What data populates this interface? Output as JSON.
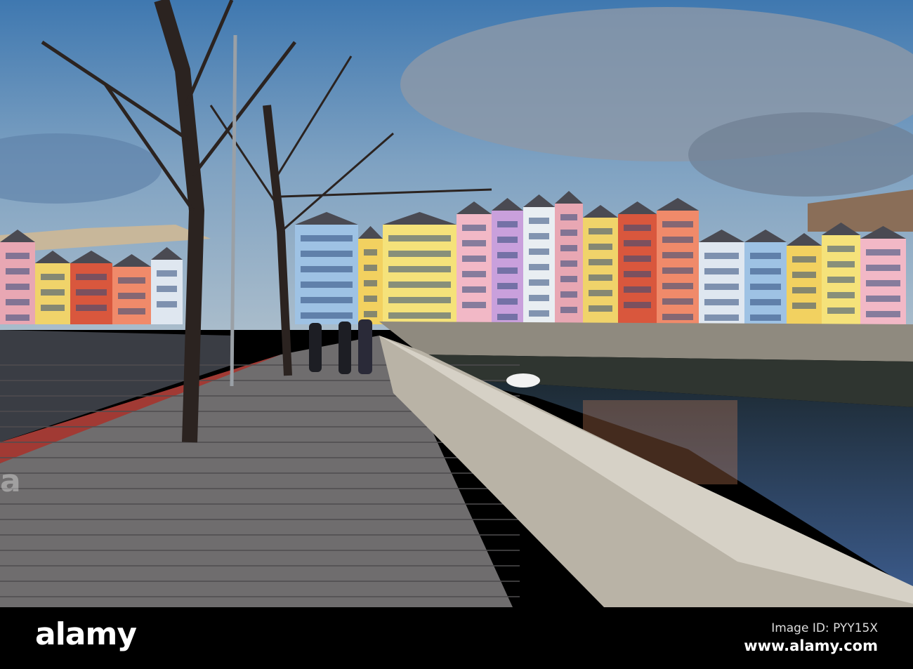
{
  "watermark": {
    "logo": "alamy",
    "image_id": "Image ID: PYY15X",
    "url": "www.alamy.com"
  },
  "scene": {
    "subject": "riverside-promenade",
    "colors": {
      "sky": "#5f8fb8",
      "cloud": "#9aa6b4",
      "wall": "#b9b3a6",
      "water": "#2c3a4a",
      "pavement": "#6f6d6e",
      "road": "#3a3d44",
      "cycle_lane": "#a13a34"
    },
    "building_colors": [
      "#e8a7b3",
      "#f0d36a",
      "#d9573d",
      "#f08a6a",
      "#dfe7f0",
      "#9ec2e4",
      "#f2d160",
      "#f5e27a",
      "#f2b8c6",
      "#c9a0dc",
      "#e9eef2"
    ]
  }
}
